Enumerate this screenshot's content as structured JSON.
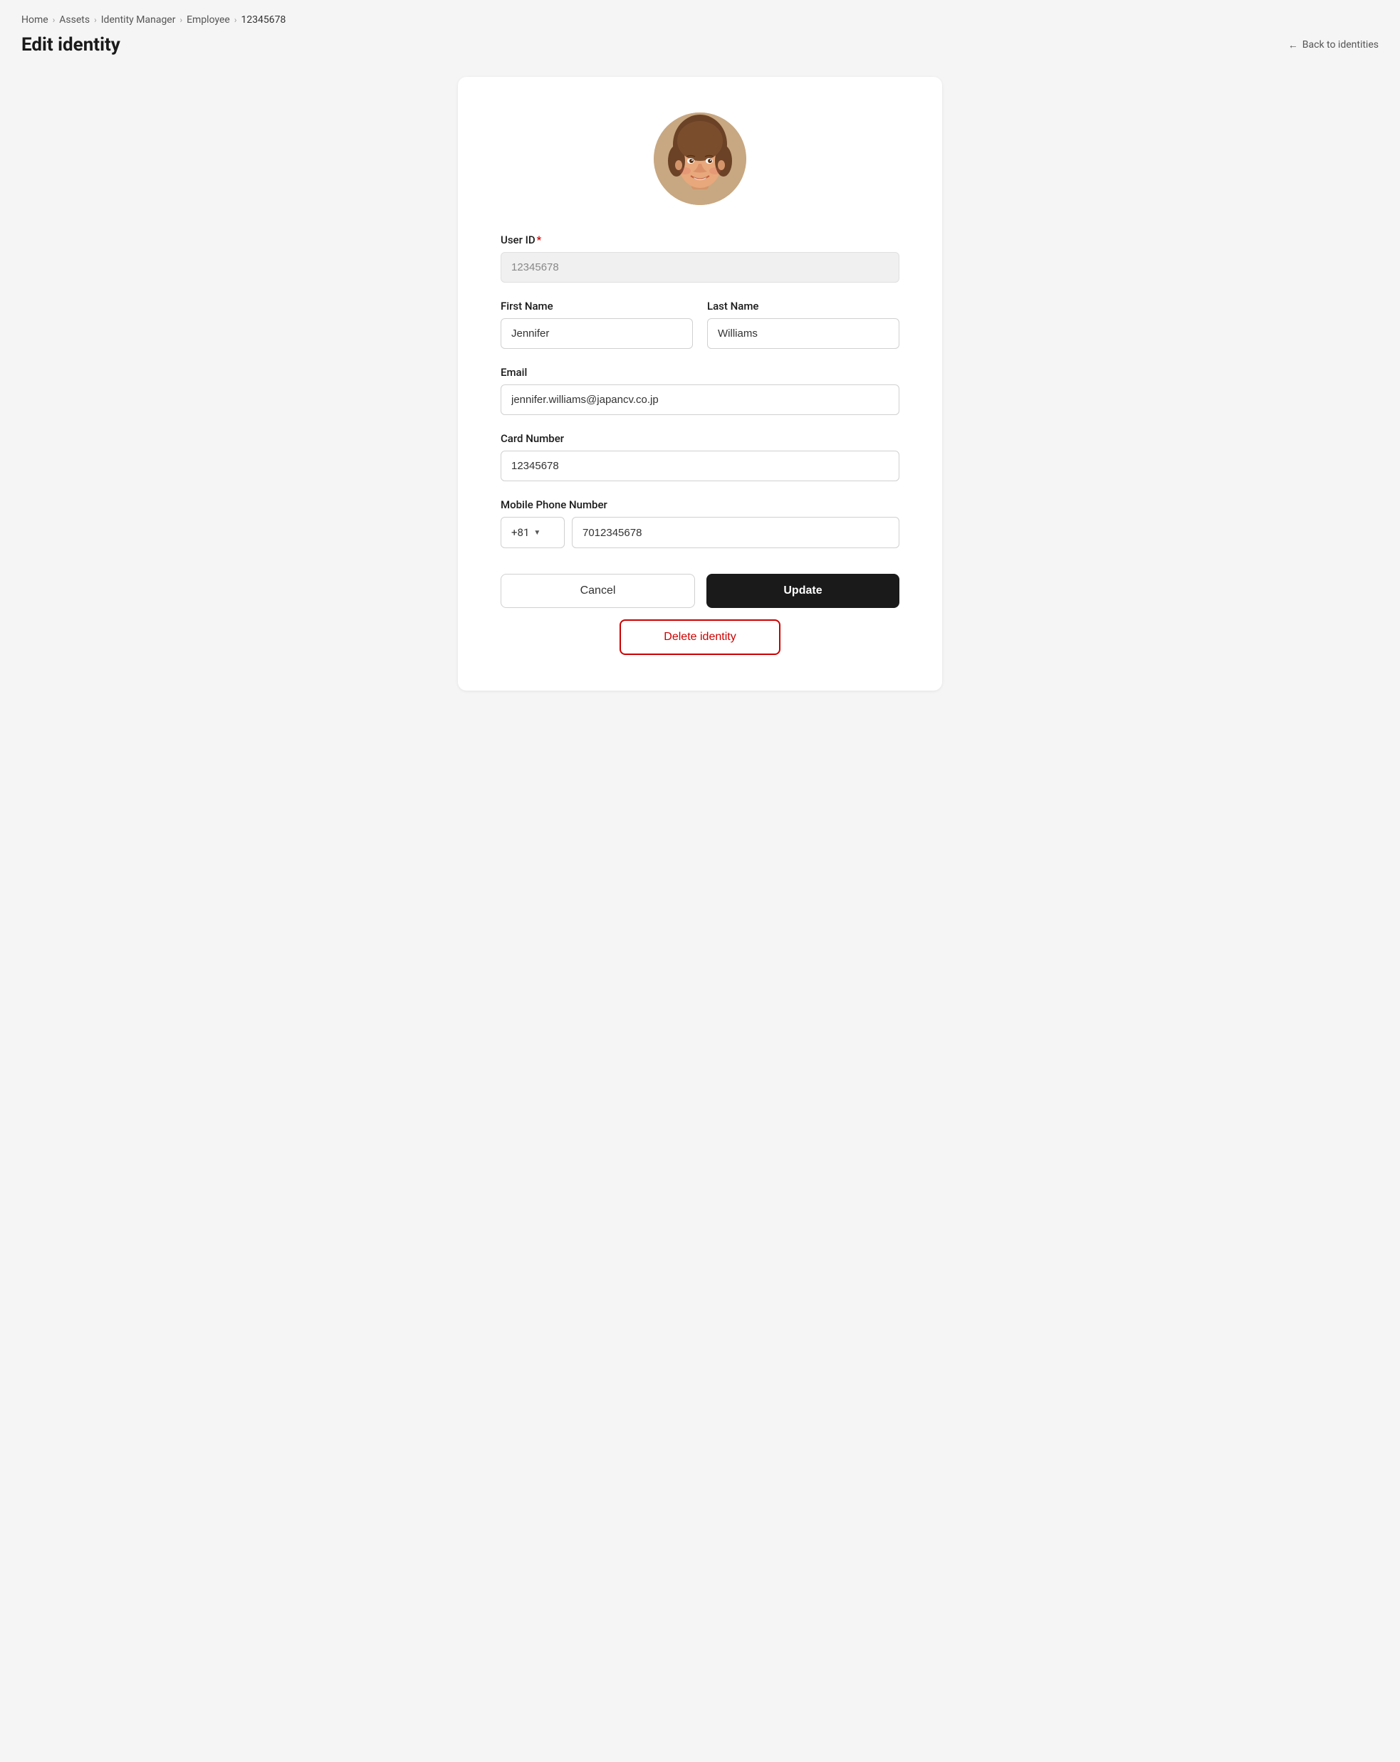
{
  "breadcrumb": {
    "items": [
      {
        "label": "Home",
        "current": false
      },
      {
        "label": "Assets",
        "current": false
      },
      {
        "label": "Identity Manager",
        "current": false
      },
      {
        "label": "Employee",
        "current": false
      },
      {
        "label": "12345678",
        "current": true
      }
    ]
  },
  "page": {
    "title": "Edit identity",
    "back_link": "Back to identities"
  },
  "form": {
    "user_id": {
      "label": "User ID",
      "value": "12345678",
      "required": true
    },
    "first_name": {
      "label": "First Name",
      "value": "Jennifer"
    },
    "last_name": {
      "label": "Last Name",
      "value": "Williams"
    },
    "email": {
      "label": "Email",
      "value": "jennifer.williams@japancv.co.jp"
    },
    "card_number": {
      "label": "Card Number",
      "value": "12345678"
    },
    "mobile_phone": {
      "label": "Mobile Phone Number",
      "country_code": "+81",
      "number": "7012345678"
    },
    "cancel_label": "Cancel",
    "update_label": "Update",
    "delete_label": "Delete identity"
  }
}
